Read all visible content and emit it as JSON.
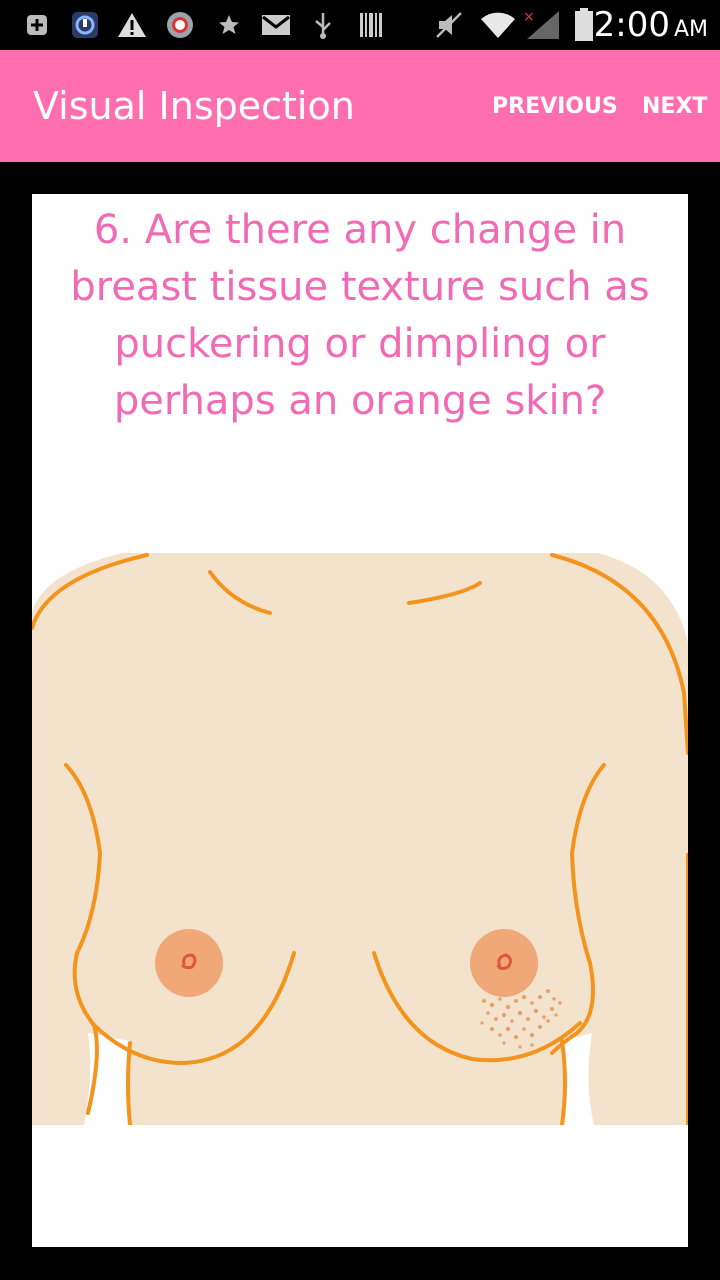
{
  "status_bar": {
    "icons": [
      "plus-box-icon",
      "app-badge-icon",
      "warning-icon",
      "sync-face-icon",
      "star-icon",
      "gmail-icon",
      "usb-icon",
      "barcode-icon",
      "mute-icon",
      "wifi-icon",
      "signal-icon",
      "battery-icon"
    ],
    "time": "2:00",
    "ampm": "AM"
  },
  "app_bar": {
    "title": "Visual Inspection",
    "previous_label": "PREVIOUS",
    "next_label": "NEXT",
    "color": "#ff6fb0"
  },
  "question": {
    "text": "6. Are there any change in breast tissue texture such as puckering or dimpling or perhaps an orange skin?",
    "color": "#f06bb4"
  },
  "illustration": {
    "skin_color": "#f3e2cc",
    "outline_color": "#f3941e",
    "areola_color": "#f0a878"
  }
}
